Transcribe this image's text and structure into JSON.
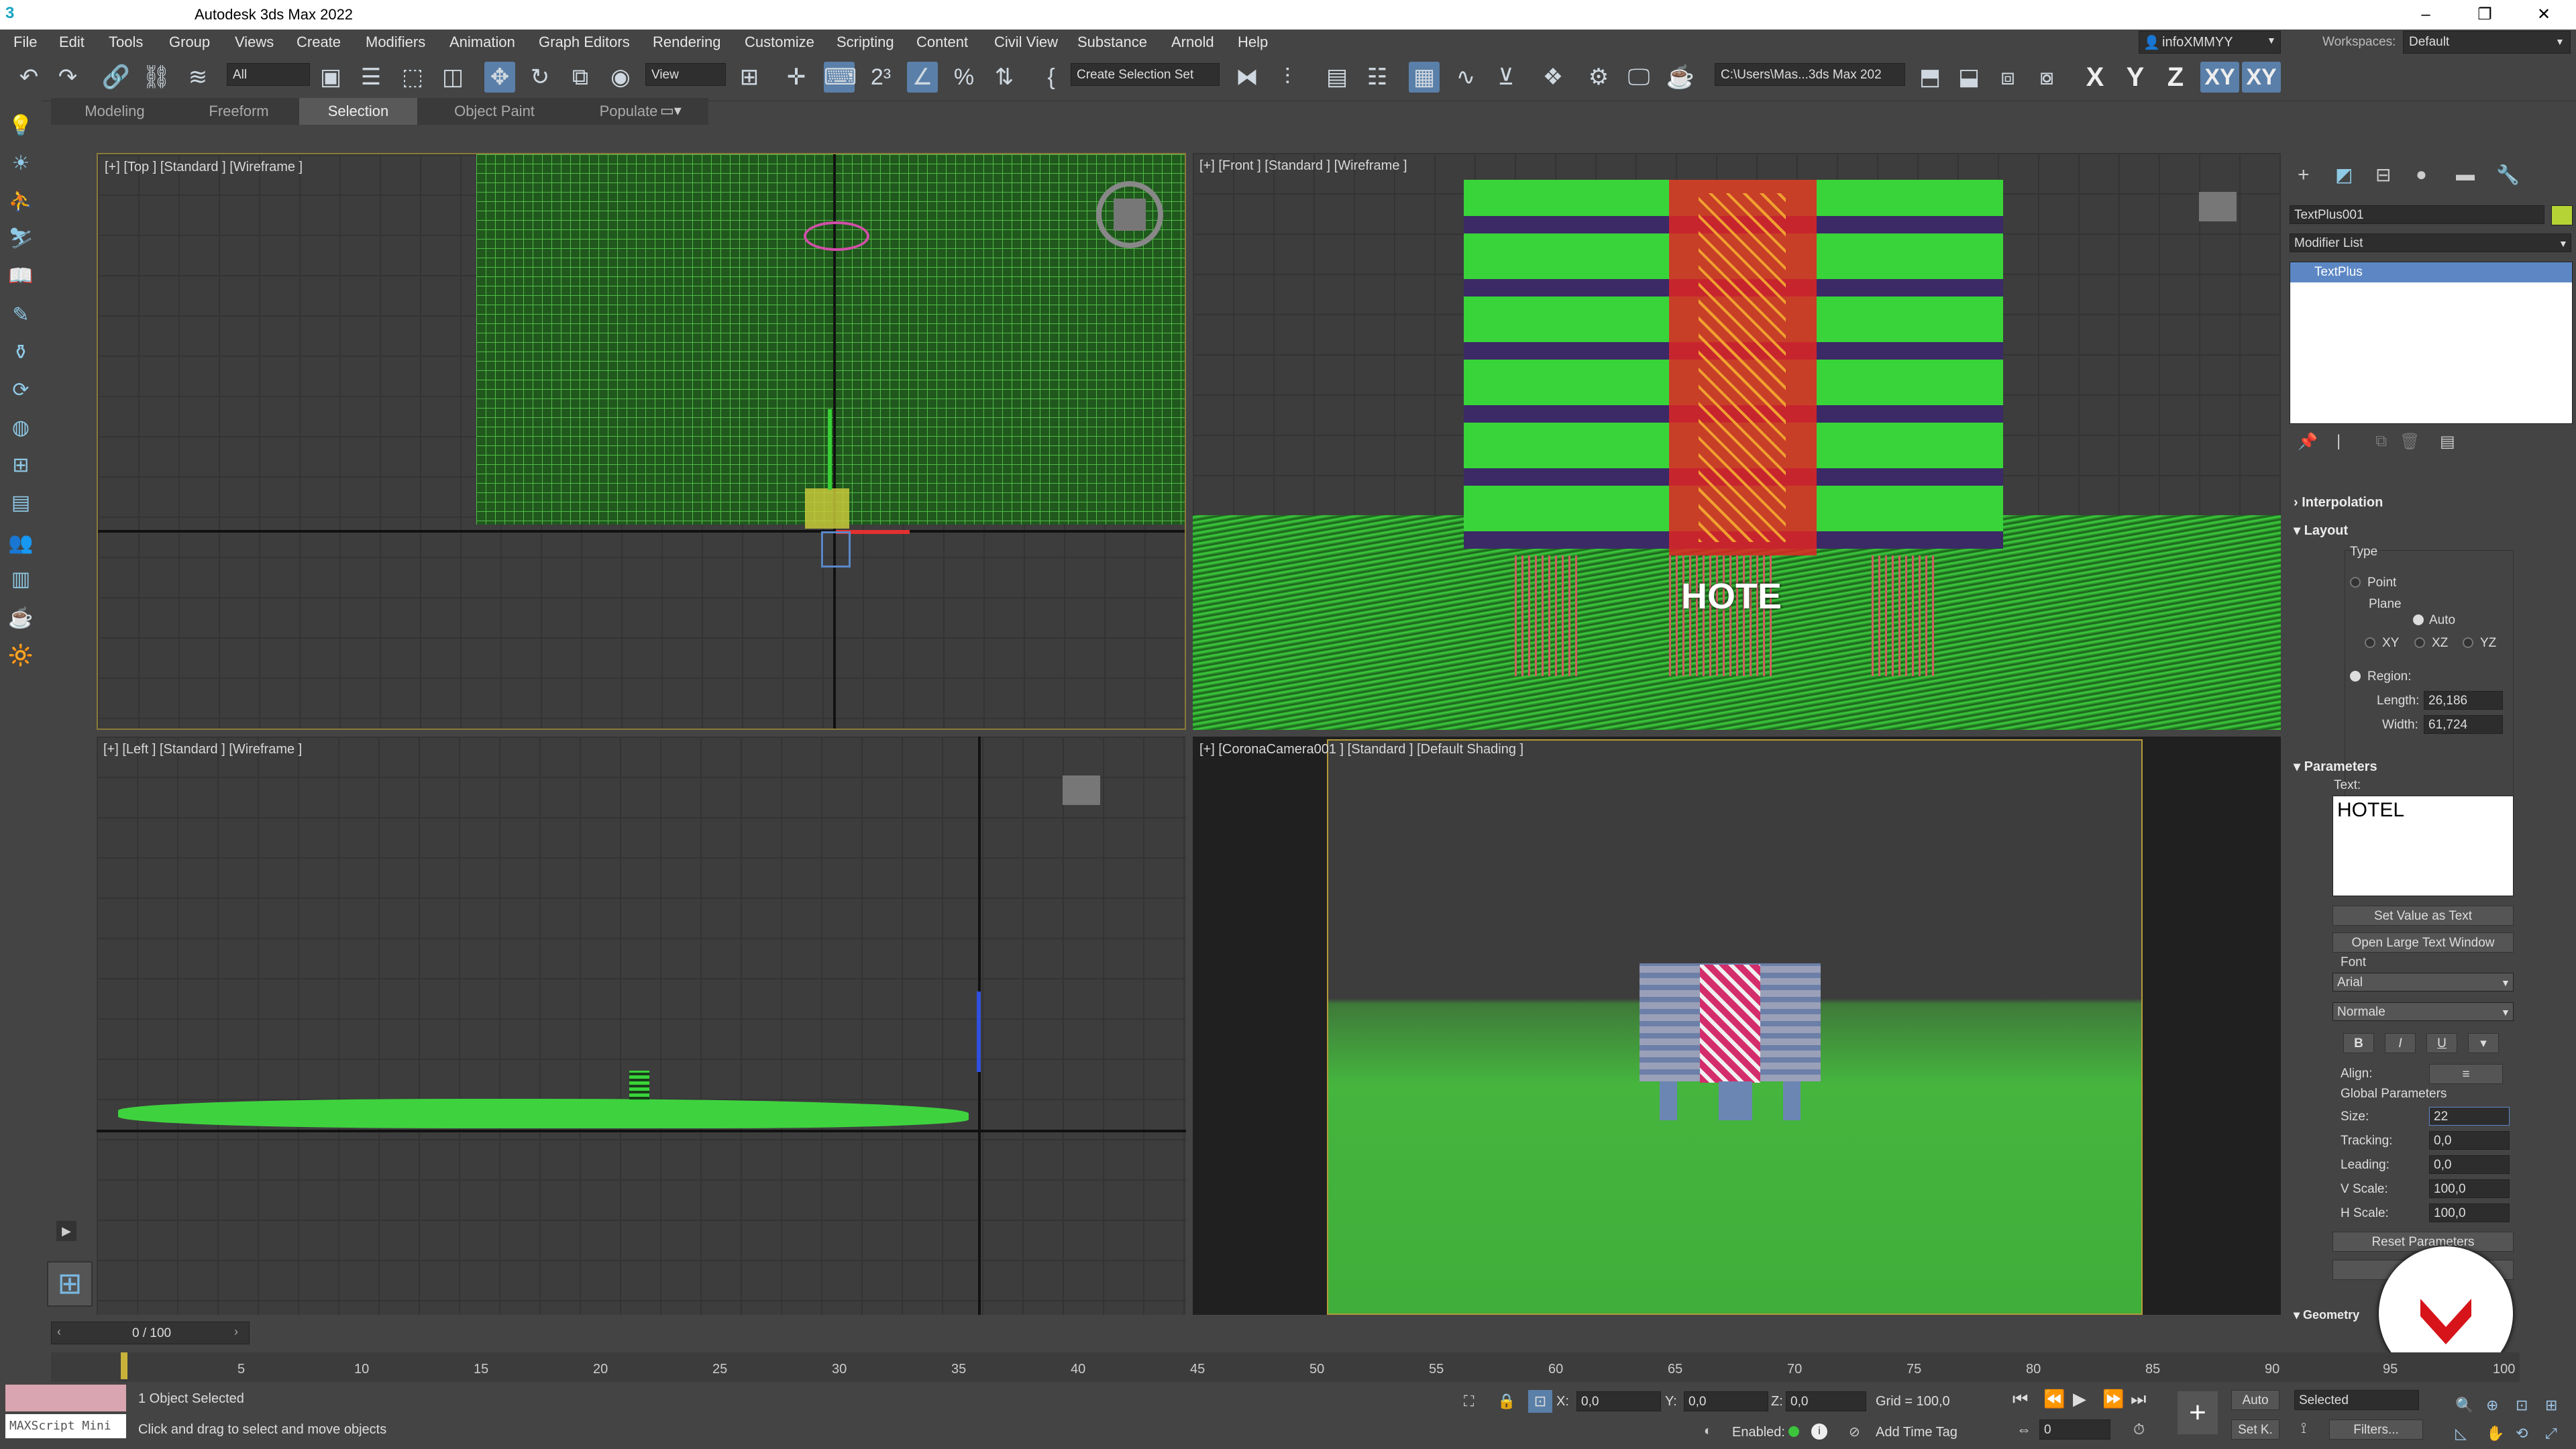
{
  "window": {
    "title": "Autodesk 3ds Max 2022",
    "app_icon": "3",
    "min": "–",
    "restore": "❐",
    "close": "✕"
  },
  "menu": [
    "File",
    "Edit",
    "Tools",
    "Group",
    "Views",
    "Create",
    "Modifiers",
    "Animation",
    "Graph Editors",
    "Rendering",
    "Customize",
    "Scripting",
    "Content",
    "Civil View",
    "Substance",
    "Arnold",
    "Help"
  ],
  "account": {
    "user": "infoXMMYY",
    "workspaces_label": "Workspaces:",
    "workspace": "Default"
  },
  "toolbar": {
    "filter": "All",
    "ref_coord": "View",
    "selection_set": "Create Selection Set",
    "project_path": "C:\\Users\\Mas...3ds Max 202",
    "axes": [
      "X",
      "Y",
      "Z",
      "XY",
      "XY"
    ]
  },
  "ribbon": {
    "tabs": [
      "Modeling",
      "Freeform",
      "Selection",
      "Object Paint",
      "Populate"
    ],
    "active": "Selection"
  },
  "viewports": {
    "top": "[+] [Top ] [Standard ] [Wireframe ]",
    "front": "[+] [Front ] [Standard ] [Wireframe ]",
    "left": "[+] [Left ] [Standard ] [Wireframe ]",
    "camera": "[+] [CoronaCamera001 ] [Standard ] [Default Shading ]",
    "front_text": "HOTE"
  },
  "command_panel": {
    "object_name": "TextPlus001",
    "object_color": "#b5d334",
    "modifier_list": "Modifier List",
    "stack": [
      "TextPlus"
    ],
    "rollouts": {
      "interpolation": "Interpolation",
      "layout": "Layout",
      "type_label": "Type",
      "point": "Point",
      "plane_label": "Plane",
      "auto": "Auto",
      "xy": "XY",
      "xz": "XZ",
      "yz": "YZ",
      "region": "Region:",
      "length_label": "Length:",
      "length": "26,186",
      "width_label": "Width:",
      "width": "61,724",
      "parameters": "Parameters",
      "text_label": "Text:",
      "text_value": "HOTEL",
      "set_value": "Set Value as Text",
      "open_large": "Open Large Text Window",
      "font_label": "Font",
      "font": "Arial",
      "style": "Normale",
      "bold": "B",
      "italic": "I",
      "underline": "U",
      "align_label": "Align:",
      "global_params": "Global Parameters",
      "size_label": "Size:",
      "size": "22",
      "tracking_label": "Tracking:",
      "tracking": "0,0",
      "leading_label": "Leading:",
      "leading": "0,0",
      "vscale_label": "V Scale:",
      "vscale": "100,0",
      "hscale_label": "H Scale:",
      "hscale": "100,0",
      "reset": "Reset Parameters",
      "manipulate": "Ma",
      "geometry": "Geometry"
    }
  },
  "timeline": {
    "frame_readout": "0 / 100",
    "ticks": [
      "5",
      "10",
      "15",
      "20",
      "25",
      "30",
      "35",
      "40",
      "45",
      "50",
      "55",
      "60",
      "65",
      "70",
      "75",
      "80",
      "85",
      "90",
      "95",
      "100"
    ]
  },
  "status": {
    "maxscript": "MAXScript Mini",
    "selected": "1 Object Selected",
    "prompt": "Click and drag to select and move objects",
    "x_label": "X:",
    "x": "0,0",
    "y_label": "Y:",
    "y": "0,0",
    "z_label": "Z:",
    "z": "0,0",
    "grid": "Grid = 100,0",
    "enabled": "Enabled:",
    "add_time_tag": "Add Time Tag",
    "auto": "Auto",
    "set_key": "Set K.",
    "selected_drop": "Selected",
    "filters": "Filters...",
    "frame": "0"
  }
}
